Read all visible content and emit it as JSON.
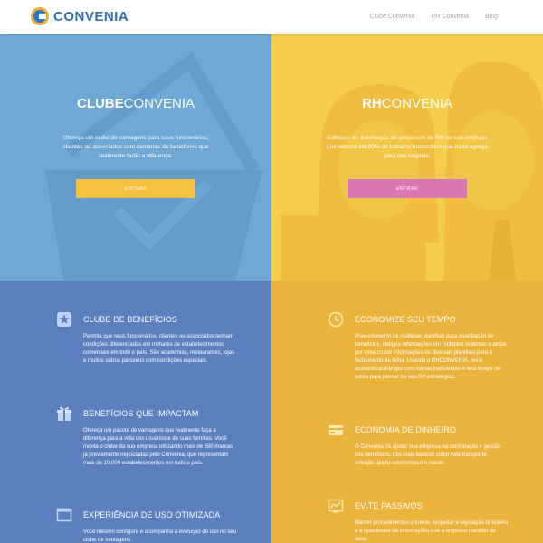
{
  "navbar": {
    "logo_text": "CONVENIA",
    "links": [
      "Clube Convenia",
      "RH Convenia",
      "Blog"
    ]
  },
  "hero_left": {
    "title_bold": "CLUBE",
    "title_light": "CONVENIA",
    "description": "Ofereça um clube de vantagens para seus funcionários, clientes ou associados com centenas de benefícios que realmente farão a diferença.",
    "button_label": "ENTRAR"
  },
  "hero_right": {
    "title_bold": "RH",
    "title_light": "CONVENIA",
    "description": "Software de automação de processos do RH da sua empresa que elimina até 99% do trabalho burocrático que nada agrega para seu negócio.",
    "button_label": "ENTRAR"
  },
  "features_left": [
    {
      "icon": "star-badge-icon",
      "title": "CLUBE DE BENEFÍCIOS",
      "text": "Permita que seus funcionários, clientes ou associados tenham condições diferenciadas em milhares de estabelecimentos comerciais em todo o país. São academias, restaurantes, lojas e muitos outros parceiros com condições especiais."
    },
    {
      "icon": "gift-icon",
      "title": "BENEFÍCIOS QUE IMPACTAM",
      "text": "Ofereça um pacote de vantagens que realmente faça a diferença para a vida dos usuários e de suas famílias. Você monta o clube da sua empresa utilizando mais de 550 marcas já previamente negociadas pelo Convenia, que representam mais de 10.000 estabelecimentos em todo o país."
    },
    {
      "icon": "window-icon",
      "title": "EXPERIÊNCIA DE USO OTIMIZADA",
      "text": "Você mesmo configura e acompanha a evolução do uso no seu clube de vantagens."
    }
  ],
  "features_right": [
    {
      "icon": "clock-icon",
      "title": "ECONOMIZE SEU TEMPO",
      "text": "Preenchimento de múltiplas planilhas para atualização de benefícios, redigira informações em múltiplos sistemas e ainda por cima cruzar informações de diversas planilhas para o fechamento da folha. Usando o RHCONVENIA, você economizará tempo com rotinas ineficientes e terá tempo de sobra para pensar no seu RH estratégico."
    },
    {
      "icon": "credit-card-icon",
      "title": "ECONOMIA DE DINHEIRO",
      "text": "O Convenia irá ajudar sua empresa na contratação e gestão dos benefícios, dos mais básicos como vale transporte, refeição, plano odontológico e saúde."
    },
    {
      "icon": "chart-icon",
      "title": "EVITE PASSIVOS",
      "text": "Manter procedimentos corretos, respeitar a legislação brasileira e a quantidade de informações que a empresa mantém de seus"
    }
  ],
  "colors": {
    "hero_left_bg": "#6fa8d5",
    "hero_right_bg": "#f6cc4c",
    "features_left_bg": "#5c7fbe",
    "features_right_bg": "#eab43c",
    "button_left": "#f5c13f",
    "button_right": "#d877b4",
    "logo_blue": "#2d6fb7"
  }
}
